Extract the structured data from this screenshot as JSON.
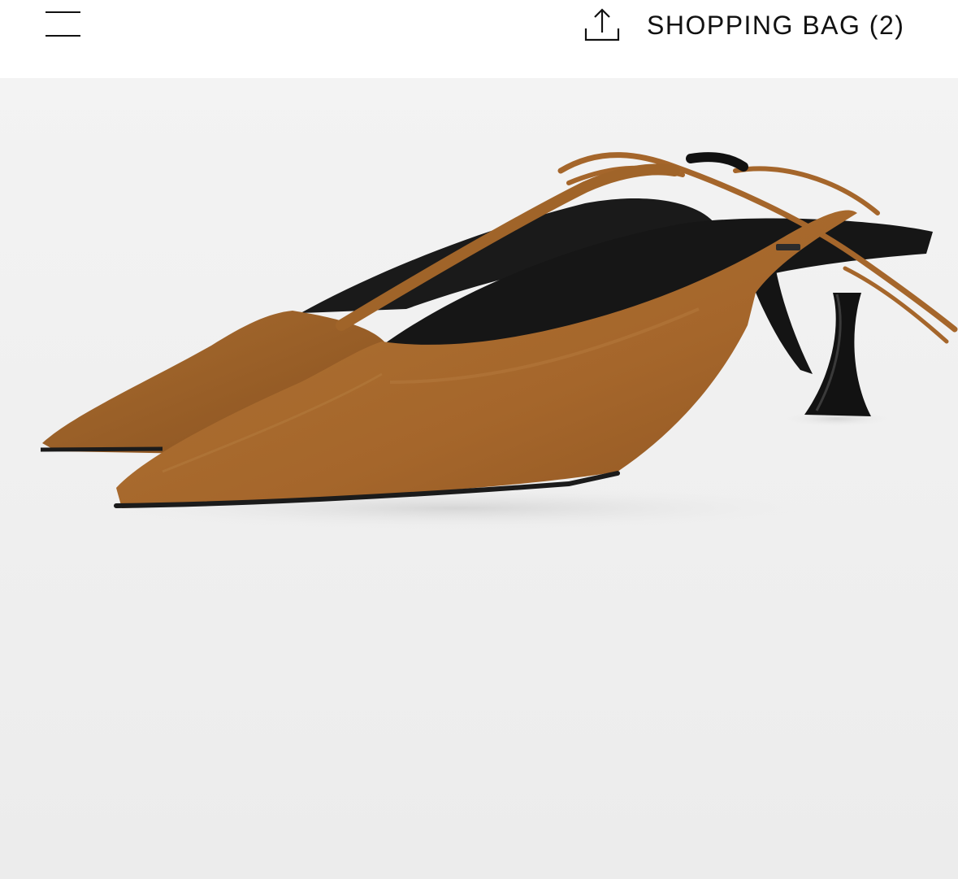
{
  "header": {
    "shopping_bag_label": "SHOPPING BAG (2)",
    "menu_icon": "hamburger-menu-icon",
    "share_icon": "share-upload-icon"
  },
  "product_image": {
    "subject": "tan suede pointed-toe slingback kitten heel with wrap ankle ties",
    "colors": {
      "suede": "#a9692c",
      "heel": "#111111",
      "background": "#efefef"
    }
  }
}
